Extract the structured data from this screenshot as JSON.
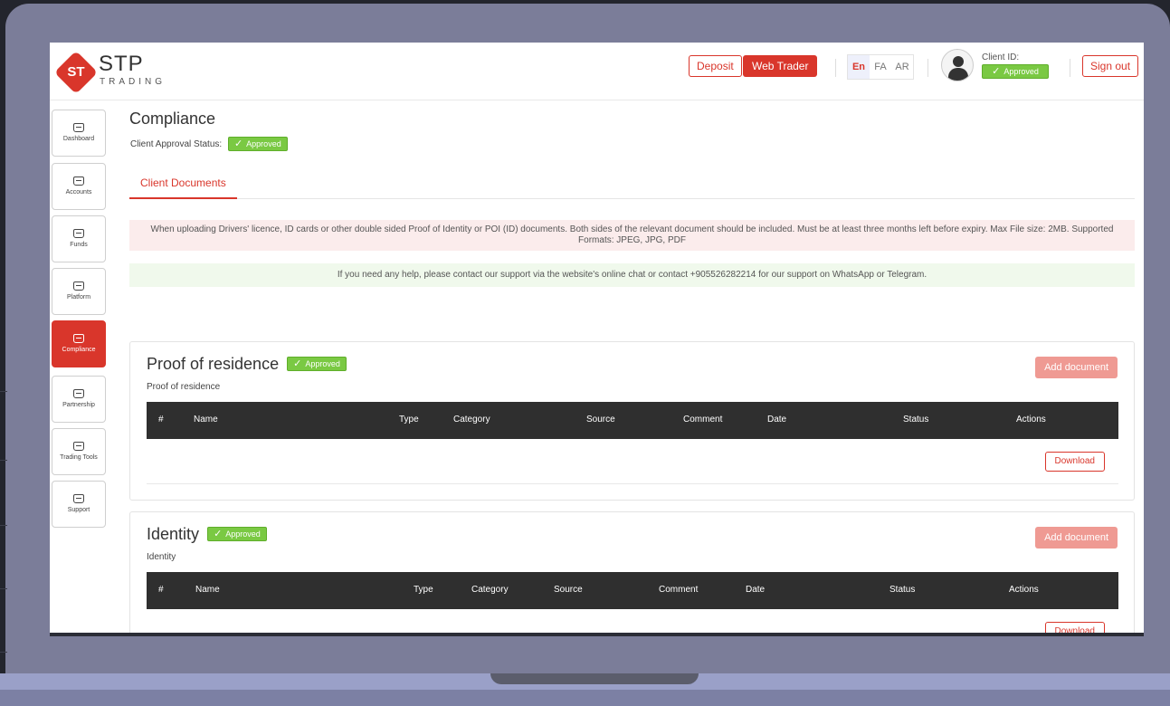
{
  "header": {
    "logo_abbrev": "ST",
    "logo_name": "STP",
    "logo_sub": "TRADING",
    "deposit_label": "Deposit",
    "web_trader_label": "Web Trader",
    "languages": [
      "En",
      "FA",
      "AR"
    ],
    "active_language": "En",
    "client_id_label": "Client ID:",
    "client_status": "Approved",
    "sign_out_label": "Sign out"
  },
  "sidebar": {
    "items": [
      {
        "label": "Dashboard",
        "icon": "home-icon",
        "active": false
      },
      {
        "label": "Accounts",
        "icon": "home-icon",
        "active": false
      },
      {
        "label": "Funds",
        "icon": "home-icon",
        "active": false
      },
      {
        "label": "Platform",
        "icon": "home-icon",
        "active": false
      },
      {
        "label": "Compliance",
        "icon": "home-icon",
        "active": true
      },
      {
        "label": "Partnership",
        "icon": "home-icon",
        "active": false
      },
      {
        "label": "Trading Tools",
        "icon": "home-icon",
        "active": false
      },
      {
        "label": "Support",
        "icon": "home-icon",
        "active": false
      }
    ]
  },
  "main": {
    "title": "Compliance",
    "approval_label": "Client Approval Status:",
    "approval_status": "Approved",
    "tab_label": "Client Documents",
    "notice_upload": "When uploading Drivers' licence, ID cards or other double sided Proof of Identity or POI (ID) documents. Both sides of the relevant document should be included. Must be at least three months left before expiry. Max File size: 2MB. Supported Formats: JPEG, JPG, PDF",
    "notice_help": "If you need any help, please contact our support via the website's online chat or contact +905526282214 for our support on WhatsApp or Telegram.",
    "sections": [
      {
        "title": "Proof of residence",
        "status": "Approved",
        "subtitle": "Proof of residence",
        "add_label": "Add document",
        "columns": [
          "#",
          "Name",
          "Type",
          "Category",
          "Source",
          "Comment",
          "Date",
          "Status",
          "Actions"
        ],
        "row_action": "Download"
      },
      {
        "title": "Identity",
        "status": "Approved",
        "subtitle": "Identity",
        "add_label": "Add document",
        "columns": [
          "#",
          "Name",
          "Type",
          "Category",
          "Source",
          "Comment",
          "Date",
          "Status",
          "Actions"
        ],
        "row_action": "Download"
      }
    ]
  },
  "colors": {
    "brand_red": "#d9362b",
    "approved_green": "#7ac943",
    "table_header": "#2f2f2f",
    "laptop_frame": "#7b7d99"
  }
}
